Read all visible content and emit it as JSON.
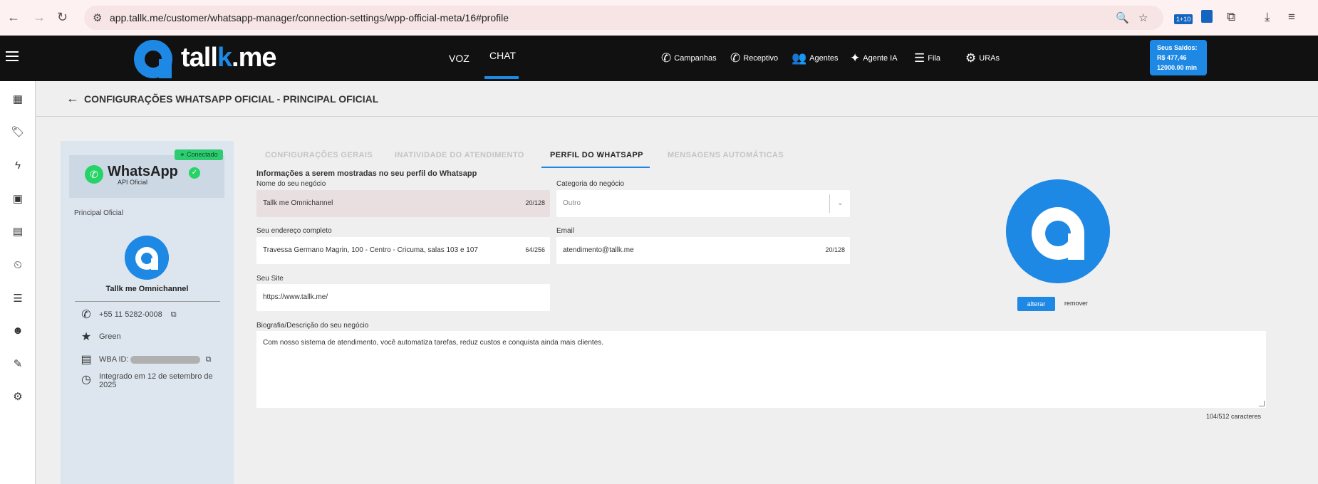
{
  "browser": {
    "url": "app.tallk.me/customer/whatsapp-manager/connection-settings/wpp-official-meta/16#profile",
    "ext_badge": "1+10"
  },
  "topnav": {
    "logo_text_a": "tall",
    "logo_text_b": "k",
    "logo_text_c": ".me",
    "tabs": [
      {
        "label": "VOZ"
      },
      {
        "label": "CHAT"
      }
    ],
    "menu": [
      {
        "label": "Campanhas",
        "icon": "phone-icon"
      },
      {
        "label": "Receptivo",
        "icon": "phone-incoming-icon"
      },
      {
        "label": "Agentes",
        "icon": "users-icon"
      },
      {
        "label": "Agente IA",
        "icon": "sparkle-icon"
      },
      {
        "label": "Fila",
        "icon": "queue-icon"
      },
      {
        "label": "URAs",
        "icon": "gear-icon"
      }
    ],
    "balance": {
      "title": "Seus Saldos:",
      "money": "R$ 477,46",
      "minutes": "12000.00 min"
    }
  },
  "page": {
    "title": "CONFIGURAÇÕES WHATSAPP OFICIAL - PRINCIPAL OFICIAL"
  },
  "card": {
    "status": "Conectado",
    "brand": "WhatsApp",
    "brand_sub": "API Oficial",
    "connection_name": "Principal Oficial",
    "business_name": "Tallk me Omnichannel",
    "phone": "+55 11 5282-0008",
    "quality": "Green",
    "wba_label": "WBA ID:",
    "integrated_line1": "Integrado em 12 de setembro de",
    "integrated_line2": "2025"
  },
  "tabs": [
    {
      "label": "CONFIGURAÇÕES GERAIS"
    },
    {
      "label": "INATIVIDADE DO ATENDIMENTO"
    },
    {
      "label": "PERFIL DO WHATSAPP"
    },
    {
      "label": "MENSAGENS AUTOMÁTICAS"
    }
  ],
  "form": {
    "heading": "Informações a serem mostradas no seu perfil do Whatsapp",
    "business_name": {
      "label": "Nome do seu negócio",
      "value": "Tallk me Omnichannel",
      "count": "20/128"
    },
    "category": {
      "label": "Categoria do negócio",
      "value": "Outro"
    },
    "address": {
      "label": "Seu endereço completo",
      "value": "Travessa Germano Magrin, 100 - Centro - Cricuma, salas 103 e 107",
      "count": "64/256"
    },
    "email": {
      "label": "Email",
      "value": "atendimento@tallk.me",
      "count": "20/128"
    },
    "site": {
      "label": "Seu Site",
      "value": "https://www.tallk.me/"
    },
    "bio": {
      "label": "Biografia/Descrição do seu negócio",
      "value": "Com nosso sistema de atendimento, você automatiza tarefas, reduz custos e conquista ainda mais clientes.",
      "count": "104/512 caracteres"
    },
    "avatar_change": "alterar",
    "avatar_remove": "remover"
  }
}
